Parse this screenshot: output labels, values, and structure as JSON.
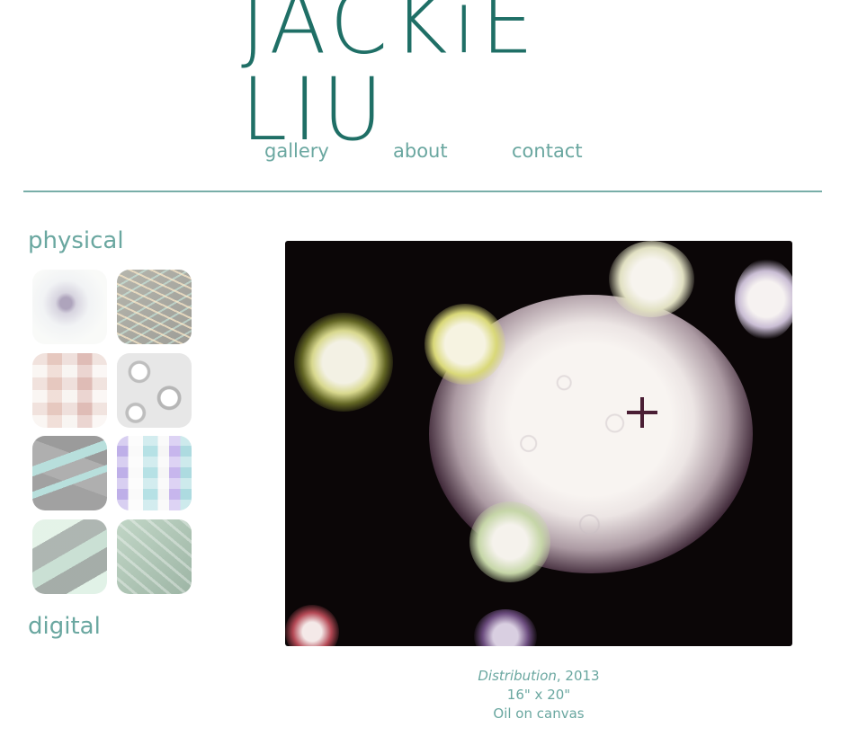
{
  "header": {
    "logo_text": "JACKiE LIU"
  },
  "nav": {
    "items": [
      "gallery",
      "about",
      "contact"
    ]
  },
  "sidebar": {
    "sections": [
      {
        "label": "physical"
      },
      {
        "label": "digital"
      }
    ]
  },
  "artwork": {
    "title": "Distribution",
    "year_suffix": ", 2013",
    "size": "16\" x 20\"",
    "medium": "Oil on canvas"
  },
  "colors": {
    "accent": "#6aa7a0",
    "logo": "#1f6f66",
    "divider": "#78aea8"
  }
}
